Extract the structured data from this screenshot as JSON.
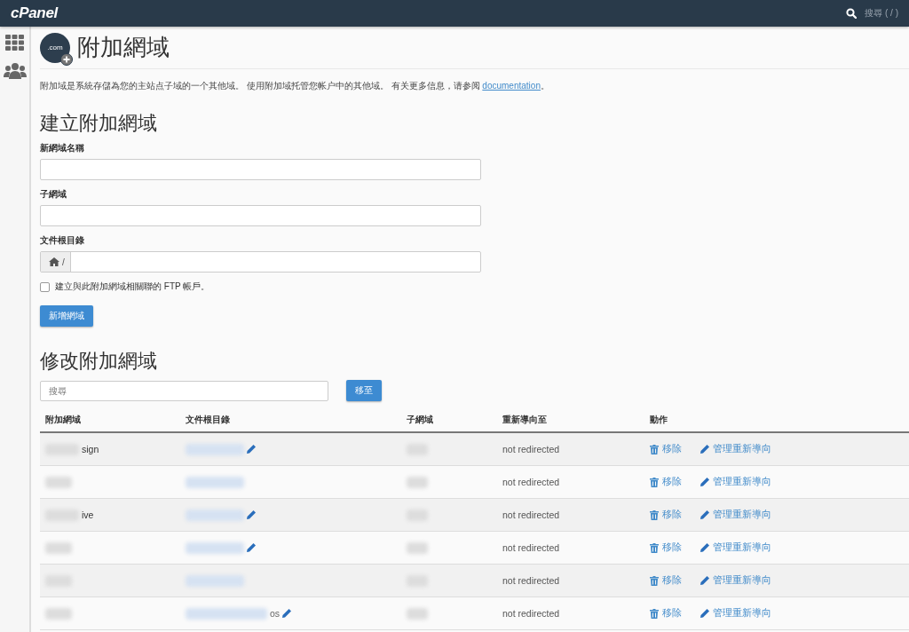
{
  "topbar": {
    "logo": "cPanel",
    "search_hint": "搜尋 ( / )"
  },
  "page": {
    "badge_text": ".com",
    "title": "附加網域",
    "description": {
      "before": "附加域是系統存儲為您的主站点子域的一个其他域。 使用附加域托管您帐户中的其他域。 有关更多信息，请参阅 ",
      "link": "documentation",
      "after": "。"
    }
  },
  "create": {
    "heading": "建立附加網域",
    "fields": [
      {
        "kind": "text",
        "label": "新網域名稱"
      },
      {
        "kind": "path",
        "label": "子網域"
      },
      {
        "kind": "path_prefix",
        "label": "文件根目錄",
        "prefix": "/"
      }
    ],
    "ftp_checkbox": {
      "label": "建立與此附加網域相關聯的 FTP 帳戶。",
      "checked": false
    },
    "submit": "新增網域"
  },
  "modify": {
    "heading": "修改附加網域",
    "search": {
      "placeholder": "搜尋"
    },
    "go_button": "移至",
    "columns": [
      "附加網域",
      "文件根目錄",
      "子網域",
      "重新導向至",
      "動作"
    ],
    "rows": [
      {
        "domain": "sign",
        "root": "",
        "editable": true,
        "redirect": "not redirected",
        "remove": "移除",
        "manage": "管理重新導向"
      },
      {
        "domain": "",
        "root": "",
        "editable": false,
        "redirect": "not redirected",
        "remove": "移除",
        "manage": "管理重新導向"
      },
      {
        "domain": "ive",
        "root": "",
        "editable": true,
        "redirect": "not redirected",
        "remove": "移除",
        "manage": "管理重新導向"
      },
      {
        "domain": "",
        "root": "",
        "editable": true,
        "redirect": "not redirected",
        "remove": "移除",
        "manage": "管理重新導向"
      },
      {
        "domain": "",
        "root": "",
        "editable": false,
        "redirect": "not redirected",
        "remove": "移除",
        "manage": "管理重新導向"
      },
      {
        "domain": "",
        "root": "os",
        "editable": true,
        "redirect": "not redirected",
        "remove": "移除",
        "manage": "管理重新導向"
      }
    ]
  }
}
